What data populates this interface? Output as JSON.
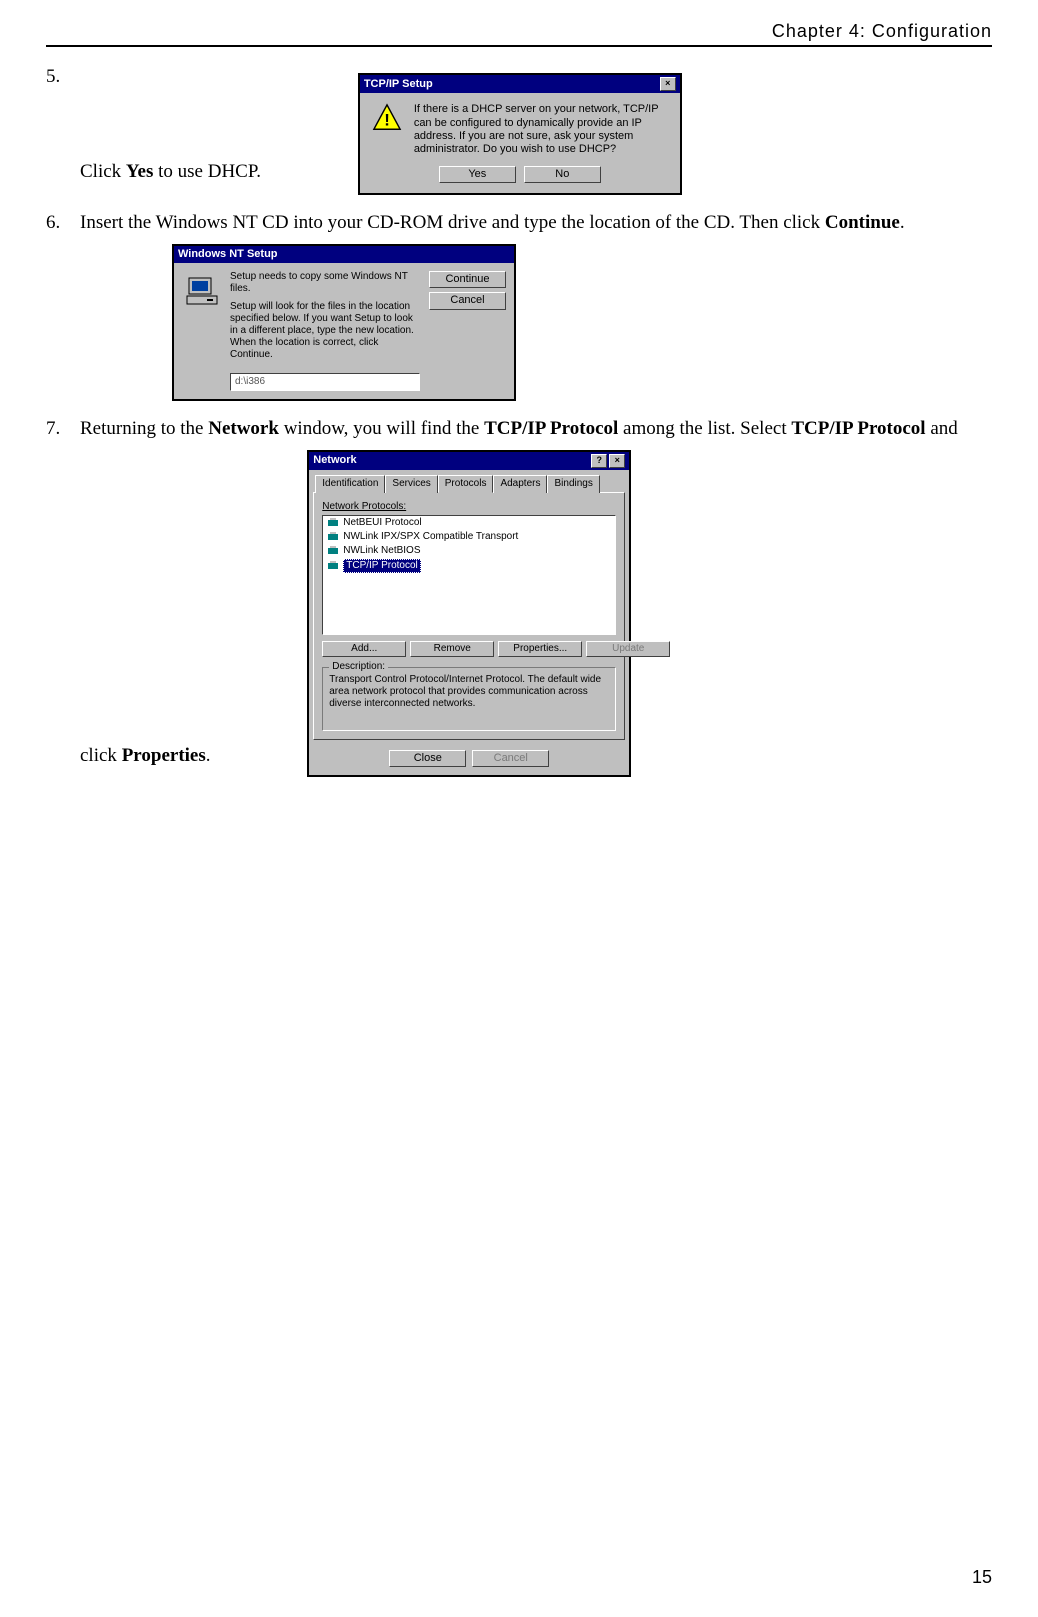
{
  "header": "Chapter 4: Configuration",
  "page_number": "15",
  "steps": {
    "s5": {
      "num": "5.",
      "text_before": "Click ",
      "bold": "Yes",
      "text_after": " to use DHCP.",
      "dialog": {
        "title": "TCP/IP Setup",
        "message": "If there is a DHCP server on your network, TCP/IP can be configured to dynamically provide an IP address. If you are not sure, ask your system administrator. Do you wish to use DHCP?",
        "yes": "Yes",
        "no": "No"
      }
    },
    "s6": {
      "num": "6.",
      "text_before": "Insert the Windows NT CD into your CD-ROM drive and type the location of the CD. Then click ",
      "bold": "Continue",
      "text_after": ".",
      "dialog": {
        "title": "Windows NT Setup",
        "line1": "Setup needs to copy some Windows NT files.",
        "line2": "Setup will look for the files in the location specified below. If you want Setup to look in a different place, type the new location. When the location is correct, click Continue.",
        "path": "d:\\i386",
        "continue": "Continue",
        "cancel": "Cancel"
      }
    },
    "s7": {
      "num": "7.",
      "seg1": "Returning to the ",
      "b1": "Network",
      "seg2": " window, you will find the ",
      "b2": "TCP/IP Protocol",
      "seg3": " among the list. Select ",
      "b3": "TCP/IP Protocol",
      "seg4": " and click ",
      "b4": "Properties",
      "seg5": ".",
      "dialog": {
        "title": "Network",
        "tabs": [
          "Identification",
          "Services",
          "Protocols",
          "Adapters",
          "Bindings"
        ],
        "active_tab": "Protocols",
        "list_label": "Network Protocols:",
        "items": [
          "NetBEUI Protocol",
          "NWLink IPX/SPX Compatible Transport",
          "NWLink NetBIOS",
          "TCP/IP Protocol"
        ],
        "selected_index": 3,
        "btn_add": "Add...",
        "btn_remove": "Remove",
        "btn_properties": "Properties...",
        "btn_update": "Update",
        "desc_label": "Description:",
        "description": "Transport Control Protocol/Internet Protocol. The default wide area network protocol that provides communication across diverse interconnected networks.",
        "close": "Close",
        "cancel": "Cancel"
      }
    }
  }
}
